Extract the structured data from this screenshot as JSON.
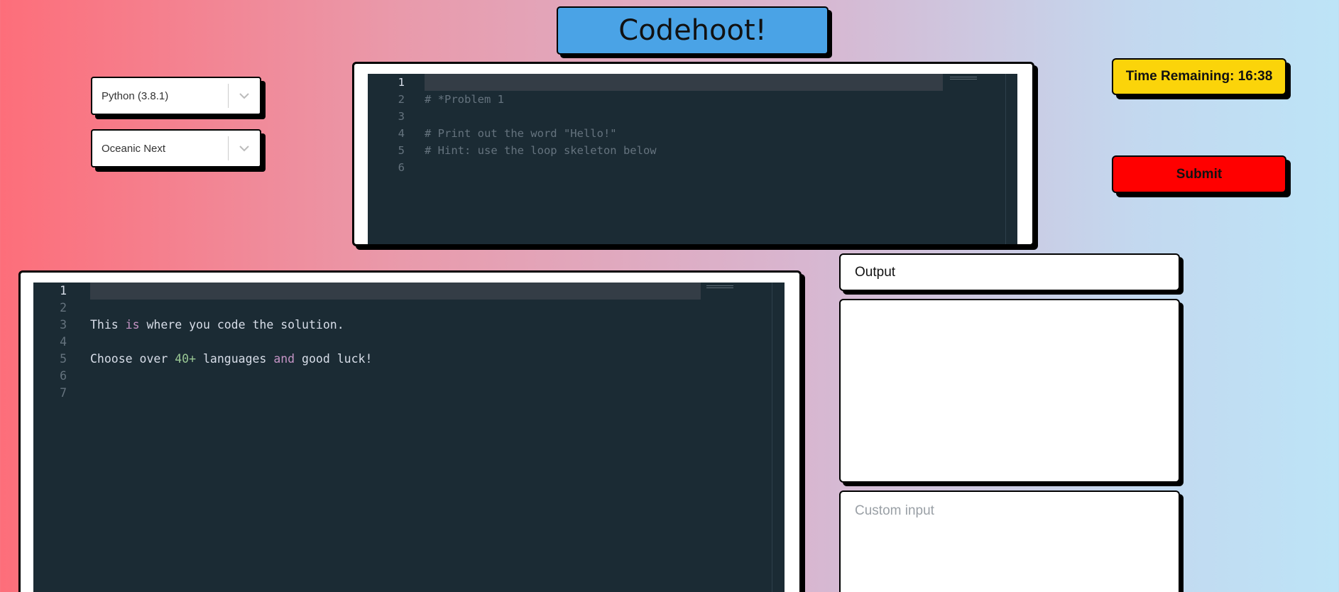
{
  "header": {
    "title": "Codehoot!"
  },
  "selectors": {
    "language": "Python (3.8.1)",
    "theme": "Oceanic Next"
  },
  "problem_editor": {
    "line_numbers": [
      "1",
      "2",
      "3",
      "4",
      "5",
      "6"
    ],
    "lines": [
      "",
      "# *Problem 1",
      "",
      "# Print out the word \"Hello!\"",
      "# Hint: use the loop skeleton below",
      ""
    ]
  },
  "solution_editor": {
    "line_numbers": [
      "1",
      "2",
      "3",
      "4",
      "5",
      "6",
      "7"
    ],
    "line3": {
      "a": "This ",
      "kw": "is",
      "b": " where you code the solution."
    },
    "line5": {
      "a": "Choose over ",
      "num": "40+",
      "b": " languages ",
      "kw": "and",
      "c": " good luck!"
    }
  },
  "timer": {
    "label": "Time Remaining: 16:38"
  },
  "submit": {
    "label": "Submit"
  },
  "output": {
    "label": "Output"
  },
  "custom_input": {
    "placeholder": "Custom input"
  },
  "colors": {
    "editor_bg": "#1b2b34",
    "title_bg": "#4aa3e6",
    "timer_bg": "#fbd40a",
    "submit_bg": "#ff0000"
  }
}
